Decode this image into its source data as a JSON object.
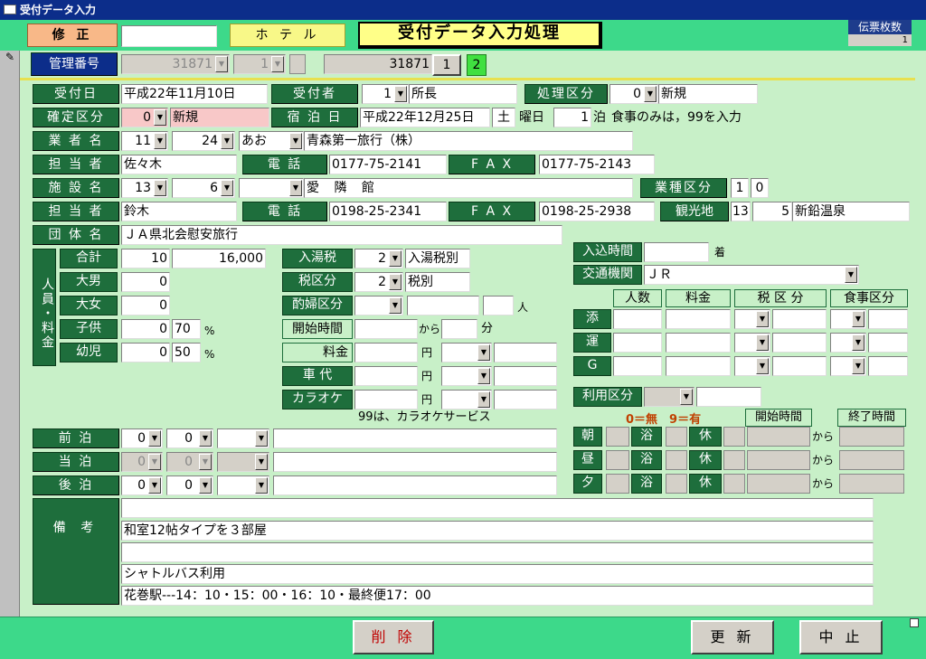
{
  "window": {
    "title": "受付データ入力"
  },
  "header": {
    "mode": "修 正",
    "mode_value": "",
    "hotel": "ホ テ ル",
    "form_title": "受付データ入力処理",
    "slip_label": "伝票枚数",
    "slip_count": "1"
  },
  "mgmt": {
    "label": "管理番号",
    "num": "31871",
    "seq": "1",
    "num2": "31871",
    "btn1": "1",
    "btn2": "2"
  },
  "reception": {
    "date_label": "受付日",
    "date": "平成22年11月10日",
    "person_label": "受付者",
    "person_code": "1",
    "person": "所長",
    "proc_label": "処理区分",
    "proc_code": "0",
    "proc": "新規"
  },
  "confirm": {
    "label": "確定区分",
    "code": "0",
    "value": "新規",
    "stay_label": "宿 泊 日",
    "stay_date": "平成22年12月25日",
    "weekday": "土",
    "weekday_suffix": "曜日",
    "nights": "1",
    "nights_suffix": "泊",
    "note": "食事のみは，99を入力"
  },
  "agent": {
    "label": "業 者 名",
    "code1": "11",
    "code2": "24",
    "kana": "あお",
    "name": "青森第一旅行（株）"
  },
  "agent_contact": {
    "label": "担 当 者",
    "name": "佐々木",
    "tel_label": "電 話",
    "tel": "0177-75-2141",
    "fax_label": "F A X",
    "fax": "0177-75-2143"
  },
  "facility": {
    "label": "施 設 名",
    "code1": "13",
    "code2": "6",
    "kana": "",
    "name": "愛 隣 館",
    "type_label": "業種区分",
    "type1": "1",
    "type2": "0"
  },
  "facility_contact": {
    "label": "担 当 者",
    "name": "鈴木",
    "tel_label": "電 話",
    "tel": "0198-25-2341",
    "fax_label": "F A X",
    "fax": "0198-25-2938",
    "tour_label": "観光地",
    "tour_code": "13",
    "tour_sub": "5",
    "tour_name": "新鉛温泉"
  },
  "group": {
    "label": "団 体 名",
    "name": "ＪＡ県北会慰安旅行"
  },
  "people": {
    "side_label": "人員・料金",
    "total_label": "合計",
    "total": "10",
    "total_fee": "16,000",
    "male_label": "大男",
    "male": "0",
    "female_label": "大女",
    "female": "0",
    "child_label": "子供",
    "child": "0",
    "child_pct": "70",
    "infant_label": "幼児",
    "infant": "0",
    "infant_pct": "50",
    "pct": "%"
  },
  "tax": {
    "bath_label": "入湯税",
    "bath_code": "2",
    "bath": "入湯税別",
    "tax_label": "税区分",
    "tax_code": "2",
    "tax": "税別",
    "comp_label": "酌婦区分",
    "comp_unit": "人",
    "start_label": "開始時間",
    "from": "から",
    "minute": "分",
    "fee_label": "料金",
    "yen": "円",
    "car_label": "車 代",
    "karaoke_label": "カラオケ",
    "karaoke_note": "99は、カラオケサービス"
  },
  "arrival": {
    "label": "入込時間",
    "suffix": "着",
    "transport_label": "交通機関",
    "transport": "ＪＲ"
  },
  "extras": {
    "h_count": "人数",
    "h_fee": "料金",
    "h_tax": "税 区 分",
    "h_meal": "食事区分",
    "r1": "添",
    "r2": "運",
    "r3": "G",
    "use_label": "利用区分"
  },
  "meals": {
    "legend": "0＝無　9＝有",
    "h_start": "開始時間",
    "h_end": "終了時間",
    "rows": [
      {
        "m": "朝",
        "bath": "浴",
        "rest": "休",
        "from": "から"
      },
      {
        "m": "昼",
        "bath": "浴",
        "rest": "休",
        "from": "から"
      },
      {
        "m": "夕",
        "bath": "浴",
        "rest": "休",
        "from": "から"
      }
    ]
  },
  "stays": {
    "prev_label": "前 泊",
    "cur_label": "当 泊",
    "next_label": "後 泊",
    "prev1": "0",
    "prev2": "0",
    "cur1": "0",
    "cur2": "0",
    "next1": "0",
    "next2": "0"
  },
  "remarks": {
    "label": "備 考",
    "lines": [
      "",
      "和室12帖タイプを３部屋",
      "",
      "シャトルバス利用",
      "花巻駅---14：10・15：00・16：10・最終便17：00"
    ]
  },
  "footer": {
    "delete": "削 除",
    "update": "更 新",
    "cancel": "中 止"
  },
  "colors": {
    "accent": "#1e6e3c",
    "band": "#3dd98a",
    "bg": "#c8f0c8"
  }
}
